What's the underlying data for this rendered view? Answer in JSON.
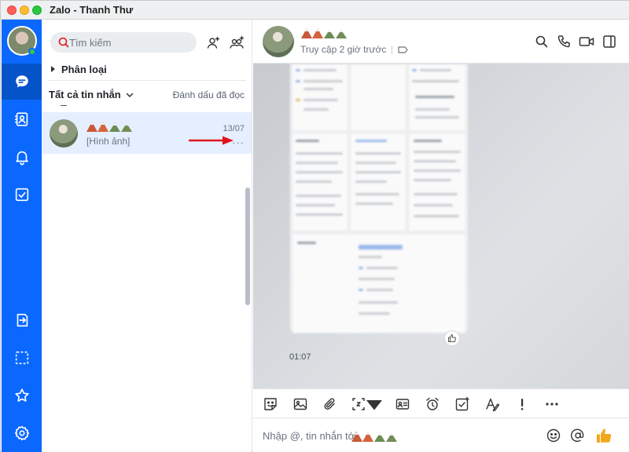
{
  "window": {
    "title": "Zalo - Thanh Thư"
  },
  "search": {
    "placeholder": "Tìm kiếm"
  },
  "list": {
    "category_label": "Phân loại",
    "filter_label": "Tất cả tin nhắn",
    "mark_read_label": "Đánh dấu đã đọc",
    "conversations": [
      {
        "preview": "[Hình ảnh]",
        "time": "13/07",
        "more": "···"
      }
    ]
  },
  "chat": {
    "status": "Truy cập 2 giờ trước",
    "message_time": "01:07",
    "composer_placeholder": "Nhập @, tin nhắn tới"
  },
  "colors": {
    "rail": "#0a68ff",
    "rail_active": "#0553c9",
    "selected_row": "#e5efff",
    "accent": "#0a68ff",
    "annotation_arrow": "#e0141a",
    "like_icon": "#f2a71b"
  },
  "icons": {
    "rail_top": [
      "chat-icon",
      "contacts-icon",
      "bell-icon",
      "todo-icon"
    ],
    "rail_bottom": [
      "send-file-icon",
      "screenshot-icon",
      "star-icon",
      "settings-icon"
    ],
    "header": [
      "search-icon",
      "phone-icon",
      "video-icon",
      "sidebar-toggle-icon"
    ],
    "toolbar": [
      "sticker-icon",
      "image-icon",
      "attach-icon",
      "screenshot-icon",
      "business-card-icon",
      "reminder-icon",
      "task-icon",
      "format-text-icon",
      "important-icon",
      "more-icon"
    ],
    "composer": [
      "emoji-icon",
      "mention-icon",
      "thumbs-up-icon"
    ]
  }
}
